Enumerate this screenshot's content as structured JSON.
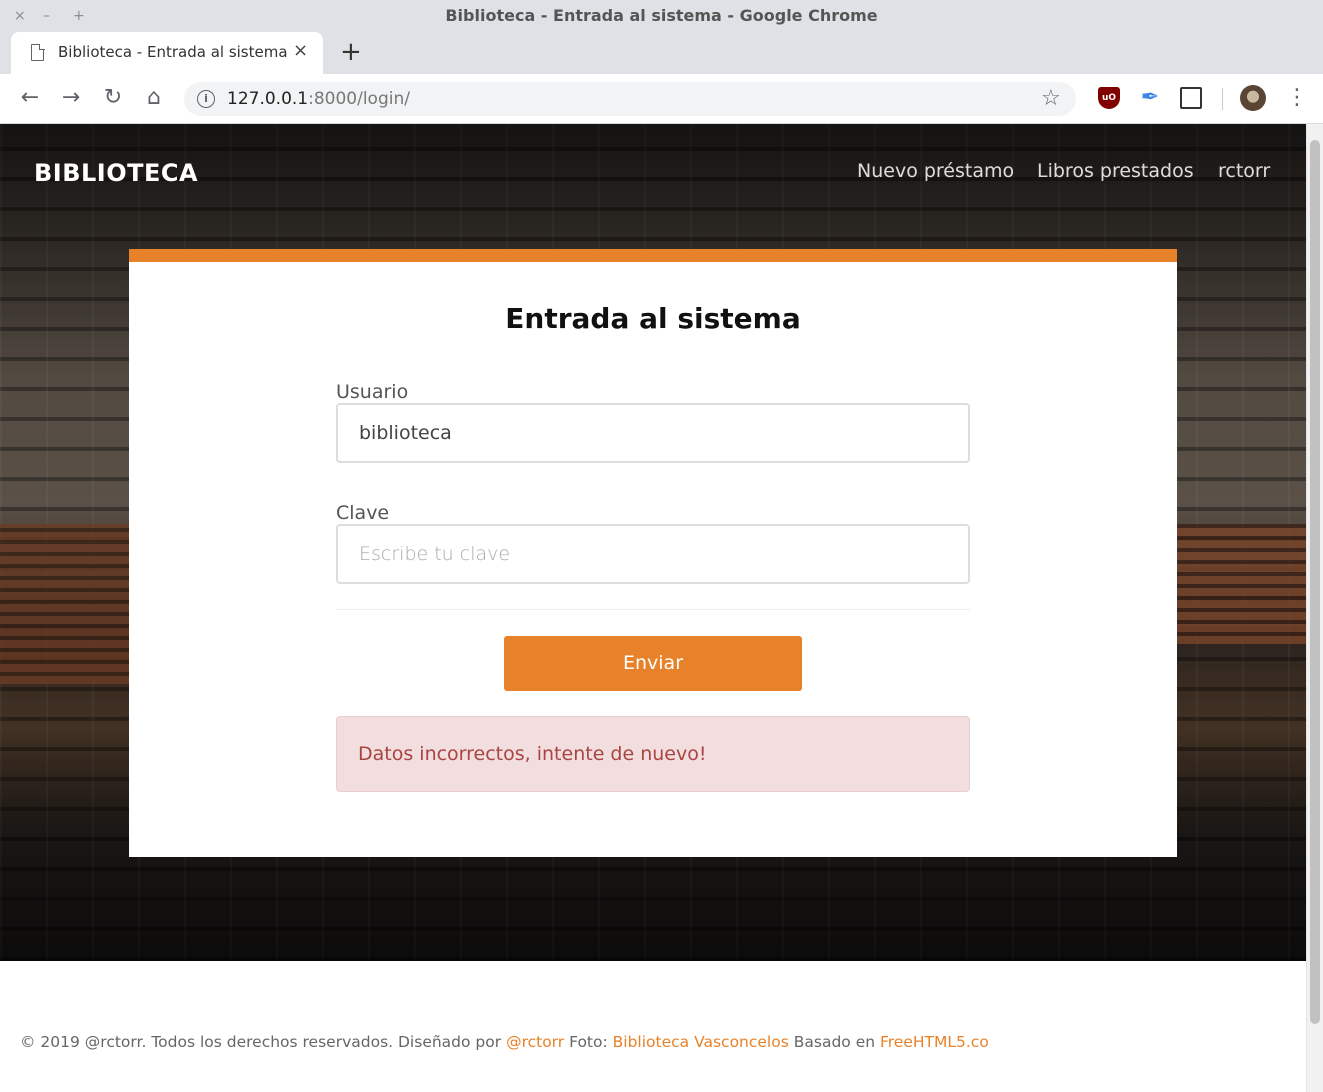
{
  "window": {
    "title": "Biblioteca - Entrada al sistema - Google Chrome",
    "controls": {
      "close": "×",
      "minimize": "–",
      "maximize": "+"
    }
  },
  "tab": {
    "title": "Biblioteca - Entrada al sistema",
    "close": "×",
    "new_tab": "+"
  },
  "toolbar": {
    "back": "←",
    "forward": "→",
    "reload": "↻",
    "home": "⌂",
    "url_host": "127.0.0.1",
    "url_rest": ":8000/login/",
    "star": "☆",
    "extensions": [
      "ublock-origin-icon",
      "feather-extension-icon",
      "screenshot-extension-icon"
    ],
    "ublock_label": "uO",
    "feather_glyph": "✒",
    "menu": "⋮"
  },
  "site": {
    "brand": "BIBLIOTECA",
    "nav": [
      "Nuevo préstamo",
      "Libros prestados",
      "rctorr"
    ]
  },
  "login": {
    "title": "Entrada al sistema",
    "username_label": "Usuario",
    "username_value": "biblioteca",
    "password_label": "Clave",
    "password_placeholder": "Escribe tu clave",
    "submit_label": "Enviar",
    "error_message": "Datos incorrectos, intente de nuevo!"
  },
  "footer": {
    "prefix": "© 2019 @rctorr. Todos los derechos reservados. Diseñado por ",
    "designer_link": "@rctorr",
    "photo_prefix": " Foto: ",
    "photo_link": "Biblioteca Vasconcelos",
    "based_prefix": " Basado en ",
    "based_link": "FreeHTML5.co"
  },
  "colors": {
    "accent": "#e8822a",
    "alert_bg": "#f2dede",
    "alert_text": "#a94442"
  }
}
